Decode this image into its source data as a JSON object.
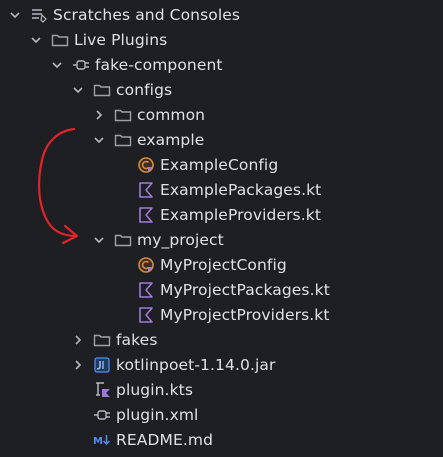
{
  "tree": {
    "items": [
      {
        "label": "Scratches and Consoles",
        "icon": "scratches-icon",
        "expanded": true
      },
      {
        "label": "Live Plugins",
        "icon": "folder-icon",
        "expanded": true
      },
      {
        "label": "fake-component",
        "icon": "plugin-icon",
        "expanded": true
      },
      {
        "label": "configs",
        "icon": "folder-icon",
        "expanded": true
      },
      {
        "label": "common",
        "icon": "folder-icon",
        "expanded": false
      },
      {
        "label": "example",
        "icon": "folder-icon",
        "expanded": true
      },
      {
        "label": "ExampleConfig",
        "icon": "kotlin-class-icon"
      },
      {
        "label": "ExamplePackages.kt",
        "icon": "kotlin-file-icon"
      },
      {
        "label": "ExampleProviders.kt",
        "icon": "kotlin-file-icon"
      },
      {
        "label": "my_project",
        "icon": "folder-icon",
        "expanded": true
      },
      {
        "label": "MyProjectConfig",
        "icon": "kotlin-class-icon"
      },
      {
        "label": "MyProjectPackages.kt",
        "icon": "kotlin-file-icon"
      },
      {
        "label": "MyProjectProviders.kt",
        "icon": "kotlin-file-icon"
      },
      {
        "label": "fakes",
        "icon": "folder-icon",
        "expanded": false
      },
      {
        "label": "kotlinpoet-1.14.0.jar",
        "icon": "jar-icon",
        "expanded": false
      },
      {
        "label": "plugin.kts",
        "icon": "kotlin-script-icon"
      },
      {
        "label": "plugin.xml",
        "icon": "plugin-icon"
      },
      {
        "label": "README.md",
        "icon": "markdown-icon"
      }
    ]
  },
  "annotation": {
    "description_icon": "hand-drawn-arrow-icon",
    "color": "#e0242a"
  },
  "colors": {
    "background": "#1e1f22",
    "text": "#dfe1e5",
    "folder": "#9ea2a8",
    "kotlin": "#9f7ad9",
    "orange": "#d98b3a"
  }
}
